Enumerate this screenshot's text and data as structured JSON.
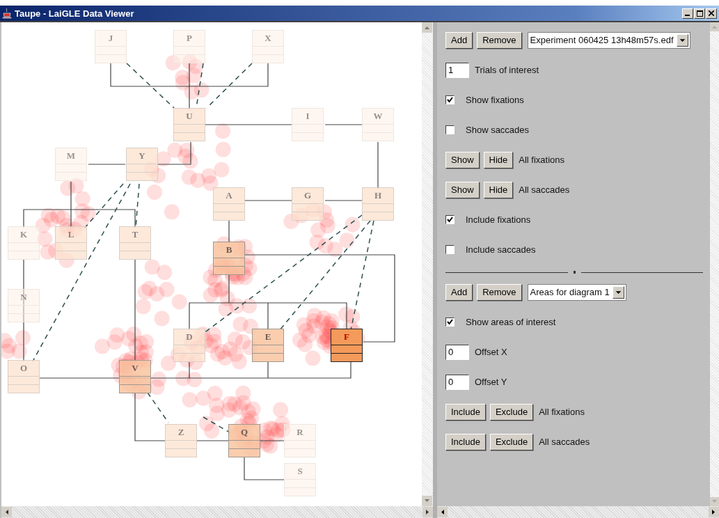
{
  "window": {
    "title": "Taupe - LaiGLE Data Viewer"
  },
  "diagram": {
    "nodes": [
      {
        "label": "J",
        "kind": "faint"
      },
      {
        "label": "P",
        "kind": "faint"
      },
      {
        "label": "X",
        "kind": "faint"
      },
      {
        "label": "U",
        "kind": "warm"
      },
      {
        "label": "I",
        "kind": "faint"
      },
      {
        "label": "W",
        "kind": "faint"
      },
      {
        "label": "M",
        "kind": "faint"
      },
      {
        "label": "Y",
        "kind": "warm"
      },
      {
        "label": "A",
        "kind": "warm"
      },
      {
        "label": "G",
        "kind": "warm"
      },
      {
        "label": "H",
        "kind": "warm"
      },
      {
        "label": "K",
        "kind": "faint"
      },
      {
        "label": "L",
        "kind": "warm"
      },
      {
        "label": "T",
        "kind": "warm"
      },
      {
        "label": "B",
        "kind": "hotter"
      },
      {
        "label": "N",
        "kind": "faint"
      },
      {
        "label": "D",
        "kind": "warm"
      },
      {
        "label": "E",
        "kind": "hotter"
      },
      {
        "label": "F",
        "kind": "hot"
      },
      {
        "label": "O",
        "kind": "warm"
      },
      {
        "label": "V",
        "kind": "hotter"
      },
      {
        "label": "Z",
        "kind": "warm"
      },
      {
        "label": "Q",
        "kind": "hotter"
      },
      {
        "label": "R",
        "kind": "faint"
      },
      {
        "label": "S",
        "kind": "faint"
      }
    ]
  },
  "panel": {
    "rows": [
      {
        "kind": "select",
        "buttons": [
          "Add",
          "Remove"
        ],
        "value": "Experiment 060425 13h48m57s.edf"
      },
      {
        "kind": "field",
        "value": "1",
        "label": "Trials of interest"
      },
      {
        "kind": "check",
        "checked": true,
        "label": "Show fixations"
      },
      {
        "kind": "check",
        "checked": false,
        "label": "Show saccades"
      },
      {
        "kind": "pair",
        "buttons": [
          "Show",
          "Hide"
        ],
        "label": "All fixations"
      },
      {
        "kind": "pair",
        "buttons": [
          "Show",
          "Hide"
        ],
        "label": "All saccades"
      },
      {
        "kind": "check",
        "checked": true,
        "label": "Include fixations"
      },
      {
        "kind": "check",
        "checked": false,
        "label": "Include saccades"
      },
      {
        "kind": "divider"
      },
      {
        "kind": "select",
        "buttons": [
          "Add",
          "Remove"
        ],
        "value": "Areas for diagram 1"
      },
      {
        "kind": "check",
        "checked": true,
        "label": "Show areas of interest"
      },
      {
        "kind": "field",
        "value": "0",
        "label": "Offset X"
      },
      {
        "kind": "field",
        "value": "0",
        "label": "Offset Y"
      },
      {
        "kind": "pair",
        "buttons": [
          "Include",
          "Exclude"
        ],
        "label": "All fixations"
      },
      {
        "kind": "pair",
        "buttons": [
          "Include",
          "Exclude"
        ],
        "label": "All saccades"
      }
    ]
  }
}
